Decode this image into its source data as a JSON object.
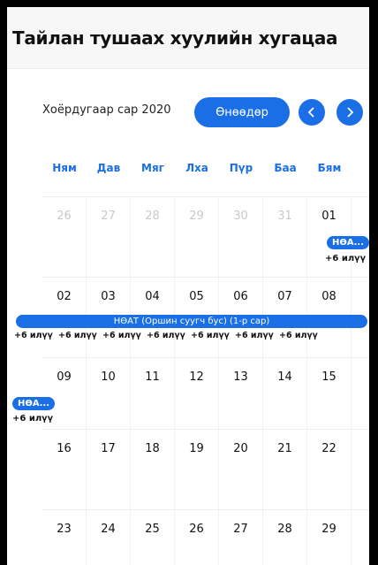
{
  "header": {
    "title": "Тайлан тушаах хуулийн хугацаа"
  },
  "toolbar": {
    "month_title": "Хоёрдугаар сар 2020",
    "today_label": "Өнөөдөр",
    "prev_icon": "chevron-left-icon",
    "next_icon": "chevron-right-icon"
  },
  "days_of_week": [
    "Ням",
    "Дав",
    "Мяг",
    "Лха",
    "Пүр",
    "Баа",
    "Бям"
  ],
  "weeks": [
    {
      "days": [
        "26",
        "27",
        "28",
        "29",
        "30",
        "31",
        "01"
      ]
    },
    {
      "days": [
        "02",
        "03",
        "04",
        "05",
        "06",
        "07",
        "08"
      ]
    },
    {
      "days": [
        "09",
        "10",
        "11",
        "12",
        "13",
        "14",
        "15"
      ]
    },
    {
      "days": [
        "16",
        "17",
        "18",
        "19",
        "20",
        "21",
        "22"
      ]
    },
    {
      "days": [
        "23",
        "24",
        "25",
        "26",
        "27",
        "28",
        "29"
      ]
    }
  ],
  "events": {
    "week1_sat_pill": "НӨА...",
    "week1_sat_more": "+6 илүү",
    "week2_bar": "НӨАТ (Оршин суугч бус) (1-р сар)",
    "week2_more": [
      "+6 илүү",
      "+6 илүү",
      "+6 илүү",
      "+6 илүү",
      "+6 илүү",
      "+6 илүү",
      "+6 илүү"
    ],
    "week3_sun_pill": "НӨА...",
    "week3_sun_more": "+6 илүү"
  },
  "colors": {
    "accent": "#1a6fe6",
    "muted_day": "#c9c9c9"
  }
}
